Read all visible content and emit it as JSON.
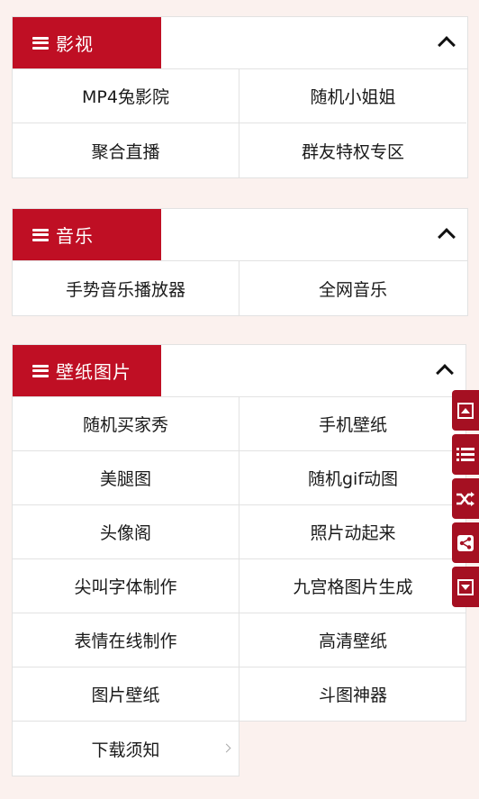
{
  "sections": [
    {
      "title": "影视",
      "items": [
        "MP4兔影院",
        "随机小姐姐",
        "聚合直播",
        "群友特权专区"
      ]
    },
    {
      "title": "音乐",
      "items": [
        "手势音乐播放器",
        "全网音乐"
      ]
    },
    {
      "title": "壁纸图片",
      "items": [
        "随机买家秀",
        "手机壁纸",
        "美腿图",
        "随机gif动图",
        "头像阁",
        "照片动起来",
        "尖叫字体制作",
        "九宫格图片生成",
        "表情在线制作",
        "高清壁纸",
        "图片壁纸",
        "斗图神器",
        "下载须知"
      ]
    }
  ],
  "side_bar": [
    "scroll-top-icon",
    "list-icon",
    "shuffle-icon",
    "share-icon",
    "scroll-bottom-icon"
  ],
  "colors": {
    "accent": "#bf0f24",
    "side": "#a51022",
    "background": "#fbf1ee"
  }
}
